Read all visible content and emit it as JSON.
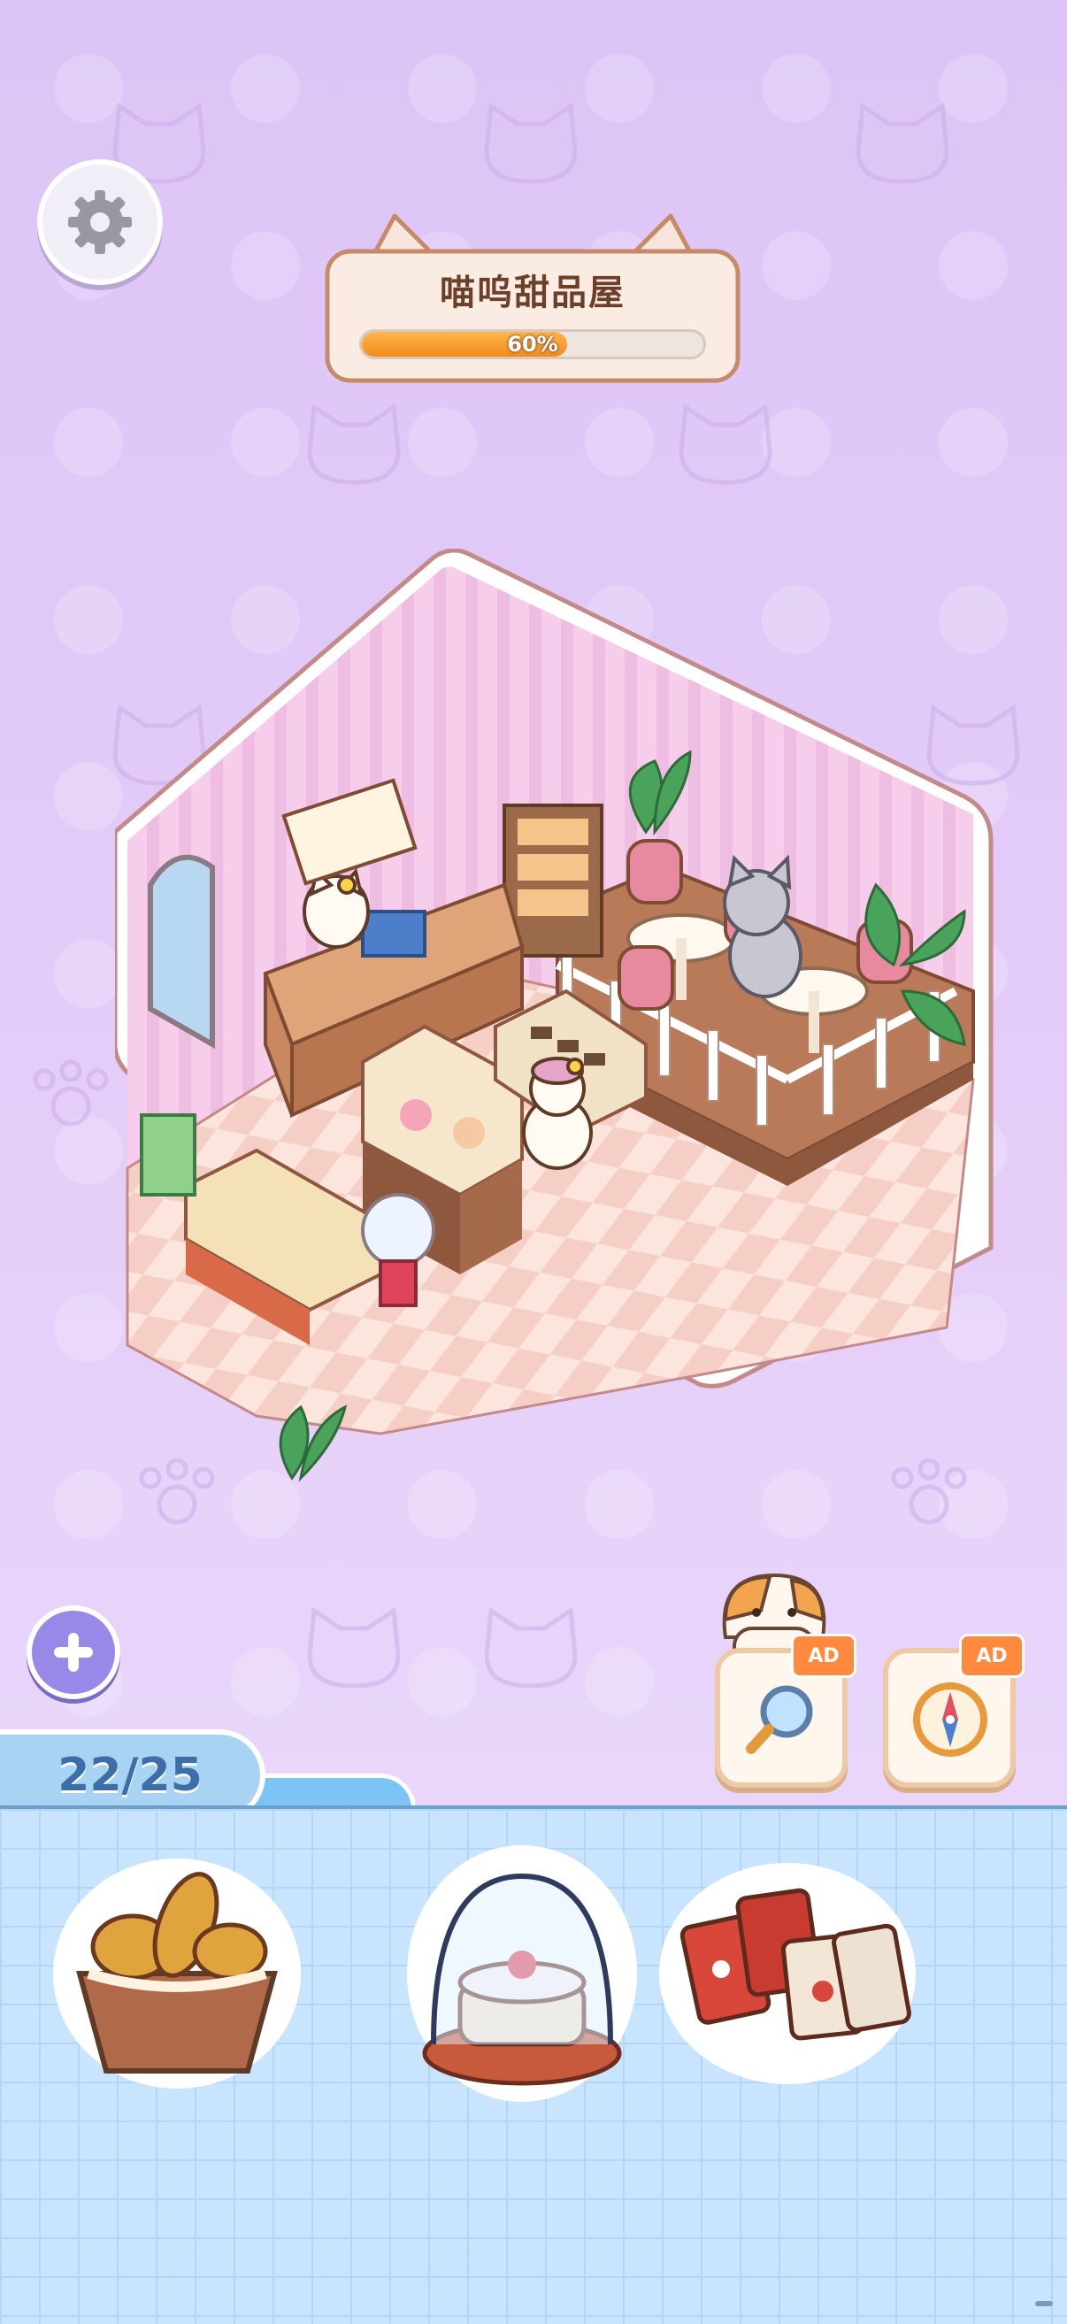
{
  "header": {
    "shop_name": "喵呜甜品屋",
    "progress_label": "60%",
    "progress_fraction": 0.6
  },
  "icons": {
    "settings": "gear-icon",
    "add": "plus-icon",
    "search_ad": "magnifier-icon",
    "compass_ad": "compass-icon",
    "mascot": "cat-icon"
  },
  "ads": {
    "search_badge": "AD",
    "compass_badge": "AD"
  },
  "inventory": {
    "counter": "22/25",
    "items": [
      {
        "name": "bread-basket-item"
      },
      {
        "name": "cake-dome-item"
      },
      {
        "name": "candy-bags-item"
      }
    ]
  },
  "colors": {
    "background": "#dcc6f5",
    "progress": "#f28a1c",
    "panel": "#c8e4ff",
    "counter": "#a9d3f3"
  }
}
